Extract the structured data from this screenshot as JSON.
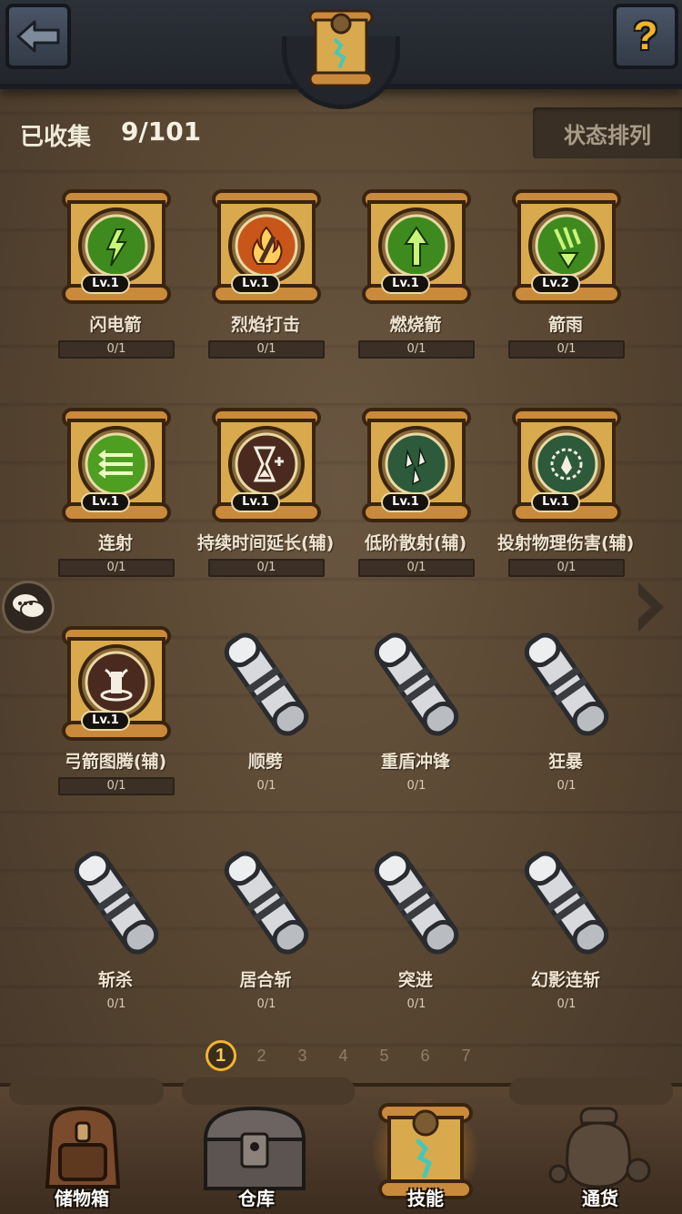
{
  "header": {
    "back_icon": "arrow-left-icon",
    "help_label": "?",
    "title_icon": "skill-scroll-icon"
  },
  "collection": {
    "label": "已收集",
    "count": "9/101",
    "sort_label": "状态排列"
  },
  "skills": [
    {
      "name": "闪电箭",
      "progress": "0/1",
      "level": "Lv.1",
      "unlocked": true,
      "icon": "lightning-arrow-icon"
    },
    {
      "name": "烈焰打击",
      "progress": "0/1",
      "level": "Lv.1",
      "unlocked": true,
      "icon": "flame-strike-icon"
    },
    {
      "name": "燃烧箭",
      "progress": "0/1",
      "level": "Lv.1",
      "unlocked": true,
      "icon": "burning-arrow-icon"
    },
    {
      "name": "箭雨",
      "progress": "0/1",
      "level": "Lv.2",
      "unlocked": true,
      "icon": "arrow-rain-icon"
    },
    {
      "name": "连射",
      "progress": "0/1",
      "level": "Lv.1",
      "unlocked": true,
      "icon": "multi-shot-icon"
    },
    {
      "name": "持续时间延长(辅)",
      "progress": "0/1",
      "level": "Lv.1",
      "unlocked": true,
      "icon": "hourglass-plus-icon"
    },
    {
      "name": "低阶散射(辅)",
      "progress": "0/1",
      "level": "Lv.1",
      "unlocked": true,
      "icon": "scatter-shot-icon"
    },
    {
      "name": "投射物理伤害(辅)",
      "progress": "0/1",
      "level": "Lv.1",
      "unlocked": true,
      "icon": "projectile-damage-icon"
    },
    {
      "name": "弓箭图腾(辅)",
      "progress": "0/1",
      "level": "Lv.1",
      "unlocked": true,
      "icon": "bow-totem-icon"
    },
    {
      "name": "顺劈",
      "progress": "0/1",
      "level": "",
      "unlocked": false,
      "icon": "locked-scroll-icon"
    },
    {
      "name": "重盾冲锋",
      "progress": "0/1",
      "level": "",
      "unlocked": false,
      "icon": "locked-scroll-icon"
    },
    {
      "name": "狂暴",
      "progress": "0/1",
      "level": "",
      "unlocked": false,
      "icon": "locked-scroll-icon"
    },
    {
      "name": "斩杀",
      "progress": "0/1",
      "level": "",
      "unlocked": false,
      "icon": "locked-scroll-icon"
    },
    {
      "name": "居合斩",
      "progress": "0/1",
      "level": "",
      "unlocked": false,
      "icon": "locked-scroll-icon"
    },
    {
      "name": "突进",
      "progress": "0/1",
      "level": "",
      "unlocked": false,
      "icon": "locked-scroll-icon"
    },
    {
      "name": "幻影连斩",
      "progress": "0/1",
      "level": "",
      "unlocked": false,
      "icon": "locked-scroll-icon"
    }
  ],
  "pagination": {
    "pages": [
      "1",
      "2",
      "3",
      "4",
      "5",
      "6",
      "7"
    ],
    "current": "1"
  },
  "nav": [
    {
      "label": "储物箱",
      "icon": "backpack-icon",
      "active": false
    },
    {
      "label": "仓库",
      "icon": "treasure-chest-icon",
      "active": false
    },
    {
      "label": "技能",
      "icon": "skill-scroll-icon",
      "active": true
    },
    {
      "label": "通货",
      "icon": "coin-bag-icon",
      "active": false
    }
  ],
  "colors": {
    "accent_gold": "#f3b431",
    "parchment": "#d9a94e",
    "green_skill": "#3f8a1e",
    "background": "#564632"
  }
}
